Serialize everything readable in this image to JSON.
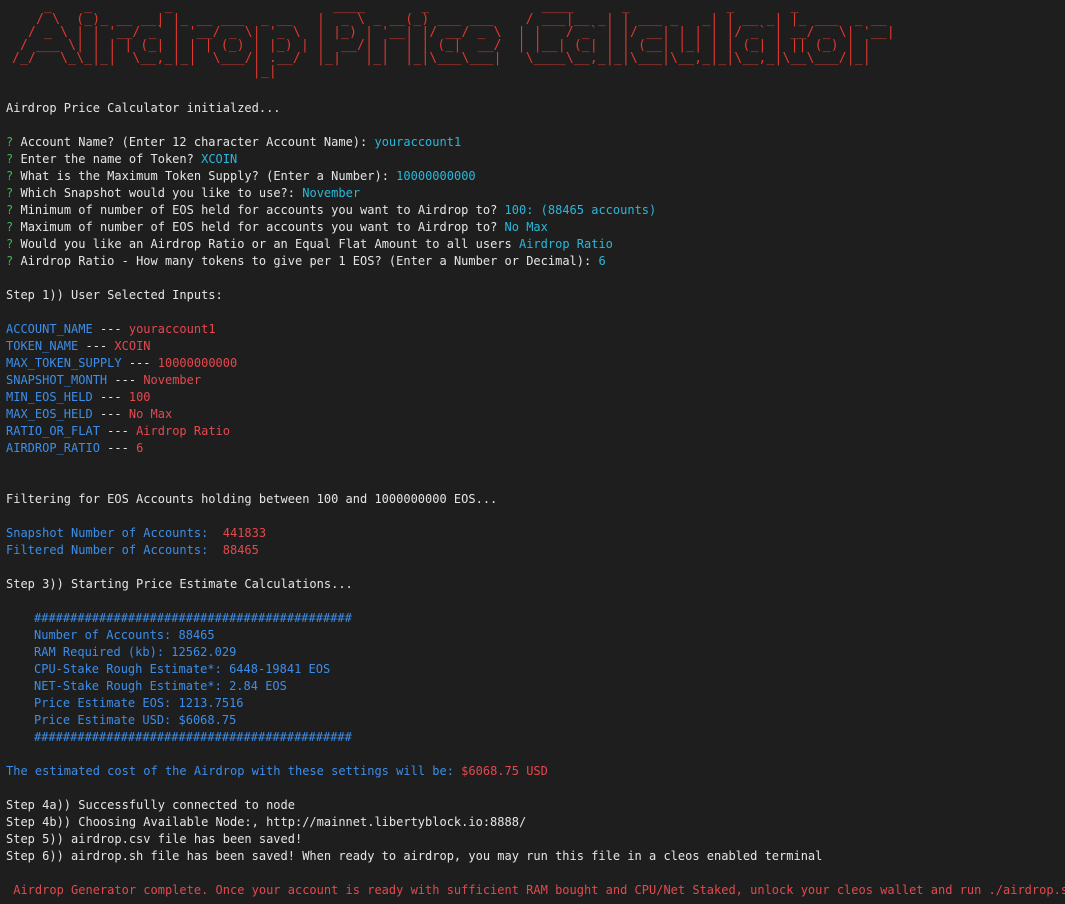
{
  "banner": {
    "ascii": "    _    _         _                    ____       _              ____      _            _       _\n   / \\  (_)_ __ __| |_ __ ___  _ __   |  _ \\ _ __(_) ___ ___    / ___|__ _| | ___ _   _| | __ _| |_ ___  _ __\n  / _ \\ | | '__/ _` | '__/ _ \\| '_ \\  | |_) | '__| |/ __/ _ \\  | |   / _` | |/ __| | | | |/ _` | __/ _ \\| '__|\n / ___ \\| | | | (_| | | | (_) | |_) | |  __/| |  | | (_|  __/  | |__| (_| | | (__| |_| | | (_| | || (_) | |\n/_/   \\_\\_|_|  \\__,_|_|  \\___/| .__/  |_|   |_|  |_|\\___\\___|   \\____\\__,_|_|\\___|\\__,_|_|\\__,_|\\__\\___/|_|\n                              |_|"
  },
  "init_message": "Airdrop Price Calculator initialzed...",
  "prompts": [
    {
      "marker": "?",
      "question": "Account Name? (Enter 12 character Account Name):",
      "answer": "youraccount1"
    },
    {
      "marker": "?",
      "question": "Enter the name of Token?",
      "answer": "XCOIN"
    },
    {
      "marker": "?",
      "question": "What is the Maximum Token Supply? (Enter a Number):",
      "answer": "10000000000"
    },
    {
      "marker": "?",
      "question": "Which Snapshot would you like to use?:",
      "answer": "November"
    },
    {
      "marker": "?",
      "question": "Minimum of number of EOS held for accounts you want to Airdrop to?",
      "answer": "100: (88465 accounts)"
    },
    {
      "marker": "?",
      "question": "Maximum of number of EOS held for accounts you want to Airdrop to?",
      "answer": "No Max"
    },
    {
      "marker": "?",
      "question": "Would you like an Airdrop Ratio or an Equal Flat Amount to all users",
      "answer": "Airdrop Ratio"
    },
    {
      "marker": "?",
      "question": "Airdrop Ratio - How many tokens to give per 1 EOS? (Enter a Number or Decimal):",
      "answer": "6"
    }
  ],
  "step1_title": "Step 1)) User Selected Inputs:",
  "separator": "---",
  "inputs": [
    {
      "key": "ACCOUNT_NAME",
      "value": "youraccount1"
    },
    {
      "key": "TOKEN_NAME",
      "value": "XCOIN"
    },
    {
      "key": "MAX_TOKEN_SUPPLY",
      "value": "10000000000"
    },
    {
      "key": "SNAPSHOT_MONTH",
      "value": "November"
    },
    {
      "key": "MIN_EOS_HELD",
      "value": "100"
    },
    {
      "key": "MAX_EOS_HELD",
      "value": "No Max"
    },
    {
      "key": "RATIO_OR_FLAT",
      "value": "Airdrop Ratio"
    },
    {
      "key": "AIRDROP_RATIO",
      "value": "6"
    }
  ],
  "filtering_message": "Filtering for EOS Accounts holding between 100 and 1000000000 EOS...",
  "snapshot_accounts": {
    "label": "Snapshot Number of Accounts:",
    "value": "441833"
  },
  "filtered_accounts": {
    "label": "Filtered Number of Accounts:",
    "value": "88465"
  },
  "step3_title": "Step 3)) Starting Price Estimate Calculations...",
  "estimate_border": "############################################",
  "estimates": [
    "Number of Accounts: 88465",
    "RAM Required (kb): 12562.029",
    "CPU-Stake Rough Estimate*: 6448-19841 EOS",
    "NET-Stake Rough Estimate*: 2.84 EOS",
    "Price Estimate EOS: 1213.7516",
    "Price Estimate USD: $6068.75"
  ],
  "estimated_cost": {
    "label": "The estimated cost of the Airdrop with these settings will be:",
    "value": "$6068.75 USD"
  },
  "steps_after": [
    "Step 4a)) Successfully connected to node",
    "Step 4b)) Choosing Available Node:, http://mainnet.libertyblock.io:8888/",
    "Step 5)) airdrop.csv file has been saved!",
    "Step 6)) airdrop.sh file has been saved! When ready to airdrop, you may run this file in a cleos enabled terminal"
  ],
  "completion_message": " Airdrop Generator complete. Once your account is ready with sufficient RAM bought and CPU/Net Staked, unlock your cleos wallet and run ./airdrop.sh",
  "colors": {
    "background": "#1e1e1e",
    "banner": "#e0392e",
    "prompt_marker": "#3fb950",
    "answer": "#29b8db",
    "key": "#3b8eea",
    "value": "#e5484d"
  }
}
